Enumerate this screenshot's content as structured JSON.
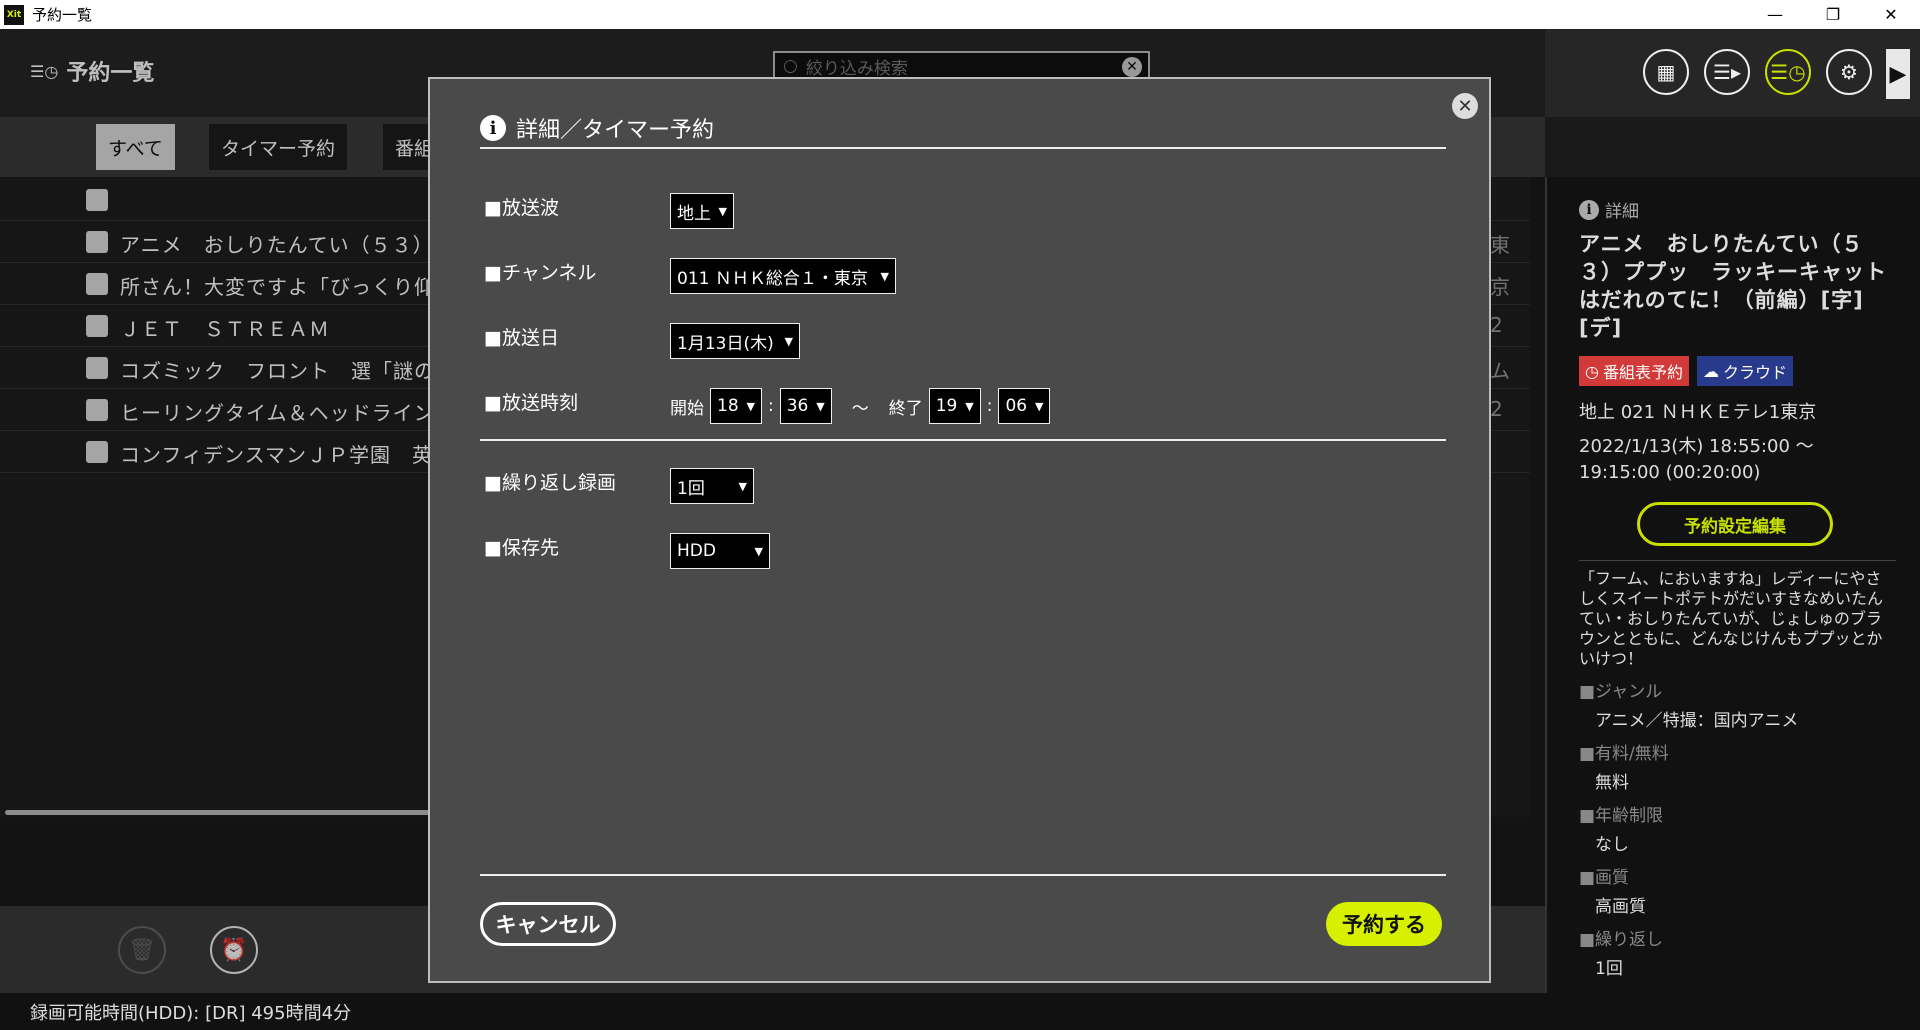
{
  "window": {
    "title": "予約一覧",
    "app_icon_text": "Xit"
  },
  "header": {
    "page_title": "予約一覧",
    "search_placeholder": "絞り込み検索"
  },
  "tabs": [
    "すべて",
    "タイマー予約",
    "番組"
  ],
  "list": {
    "rows": [
      {
        "title": "アニメ　おしりたんてい（５３）",
        "end": "東"
      },
      {
        "title": "所さん！大変ですよ「びっくり仰",
        "end": "京"
      },
      {
        "title": "ＪＥＴ　ＳＴＲＥＡＭ",
        "end": "2"
      },
      {
        "title": "コズミック　フロント　選「謎の",
        "end": "ム"
      },
      {
        "title": "ヒーリングタイム＆ヘッドライン",
        "end": "2"
      },
      {
        "title": "コンフィデンスマンＪＰ学園　英",
        "end": ""
      }
    ]
  },
  "status": {
    "recording_time": "録画可能時間(HDD): [DR] 495時間4分"
  },
  "side": {
    "detail_label": "詳細",
    "title": "アニメ　おしりたんてい（５３）ププッ　ラッキーキャット　はだれのてに！（前編）[字][デ]",
    "badge_epg": "番組表予約",
    "badge_cloud": "クラウド",
    "channel": "地上 021 ＮＨＫＥテレ1東京",
    "datetime": "2022/1/13(木) 18:55:00 ～ 19:15:00 (00:20:00)",
    "edit_button": "予約設定編集",
    "description": "「フーム、におい​ますね」レディーにやさしくスイートポテトがだいすきなめいたんてい・おしりたんていが、じょしゅのブラウンとともに、どんなじけんもププッとかいけつ！",
    "fields": [
      {
        "key": "■ジャンル",
        "value": "アニメ／特撮：国内アニメ"
      },
      {
        "key": "■有料/無料",
        "value": "無料"
      },
      {
        "key": "■年齢制限",
        "value": "なし"
      },
      {
        "key": "■画質",
        "value": "高画質"
      },
      {
        "key": "■繰り返し",
        "value": "1回"
      }
    ]
  },
  "modal": {
    "title": "詳細／タイマー予約",
    "labels": {
      "broadcast": "■放送波",
      "channel": "■チャンネル",
      "date": "■放送日",
      "time": "■放送時刻",
      "repeat": "■繰り返し録画",
      "storage": "■保存先"
    },
    "values": {
      "broadcast": "地上",
      "channel": "011 ＮＨＫ総合１・東京",
      "date": "1月13日(木)",
      "start_label": "開始",
      "start_h": "18",
      "start_m": "36",
      "tilde": "～",
      "end_label": "終了",
      "end_h": "19",
      "end_m": "06",
      "repeat": "1回",
      "storage": "HDD"
    },
    "cancel": "キャンセル",
    "submit": "予約する"
  }
}
